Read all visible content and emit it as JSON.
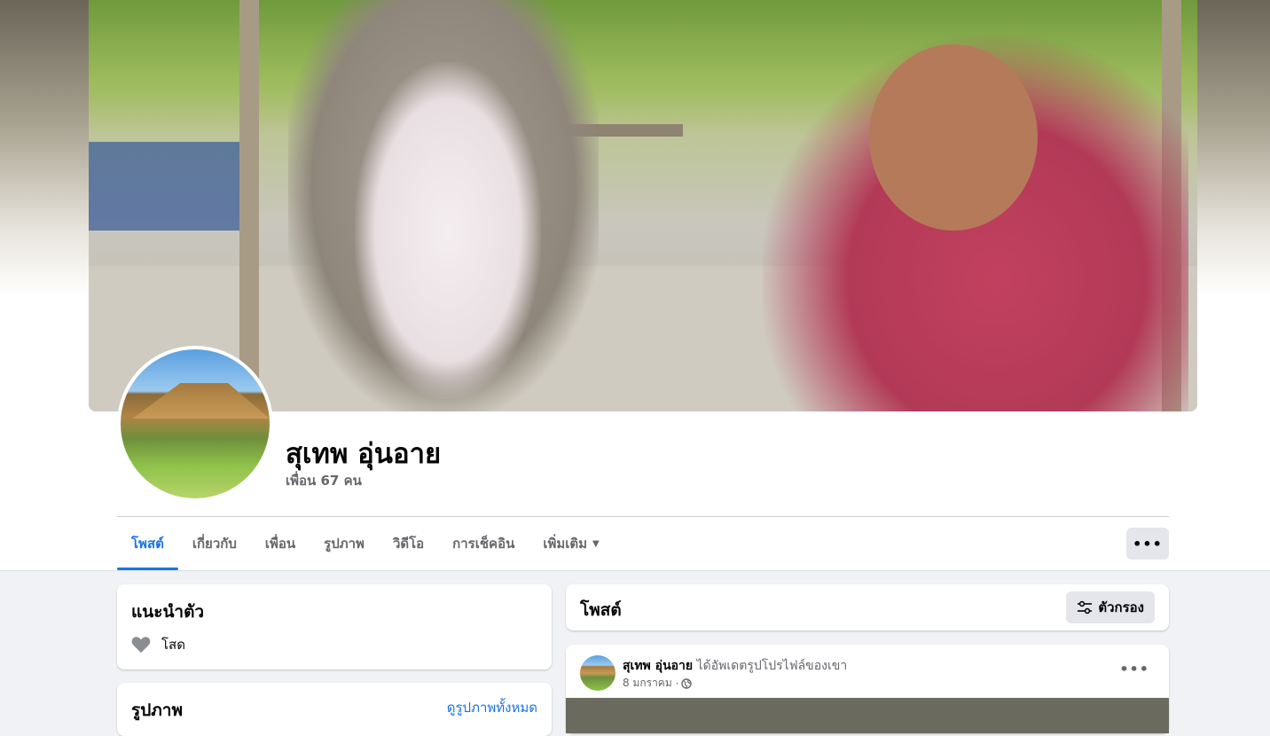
{
  "profile": {
    "name": "สุเทพ อุ่นอาย",
    "friends": "เพื่อน 67 คน"
  },
  "tabs": [
    {
      "label": "โพสต์",
      "active": true
    },
    {
      "label": "เกี่ยวกับ",
      "active": false
    },
    {
      "label": "เพื่อน",
      "active": false
    },
    {
      "label": "รูปภาพ",
      "active": false
    },
    {
      "label": "วิดีโอ",
      "active": false
    },
    {
      "label": "การเช็คอิน",
      "active": false
    },
    {
      "label": "เพิ่มเติม",
      "active": false
    }
  ],
  "intro": {
    "title": "แนะนำตัว",
    "relationship": "โสด"
  },
  "photos": {
    "title": "รูปภาพ",
    "see_all": "ดูรูปภาพทั้งหมด"
  },
  "posts": {
    "title": "โพสต์",
    "filter_label": "ตัวกรอง"
  },
  "post": {
    "author": "สุเทพ อุ่นอาย",
    "action": "ได้อัพเดตรูปโปรไฟล์ของเขา",
    "date": "8 มกราคม"
  },
  "icons": {
    "more": "more-horizontal-icon",
    "filter": "sliders-icon",
    "heart": "heart-icon",
    "globe": "globe-icon",
    "caret": "caret-down-icon"
  },
  "colors": {
    "accent": "#1b74e4",
    "secondary_text": "#65676b",
    "button_bg": "#e4e6eb",
    "page_bg": "#f0f2f5"
  }
}
